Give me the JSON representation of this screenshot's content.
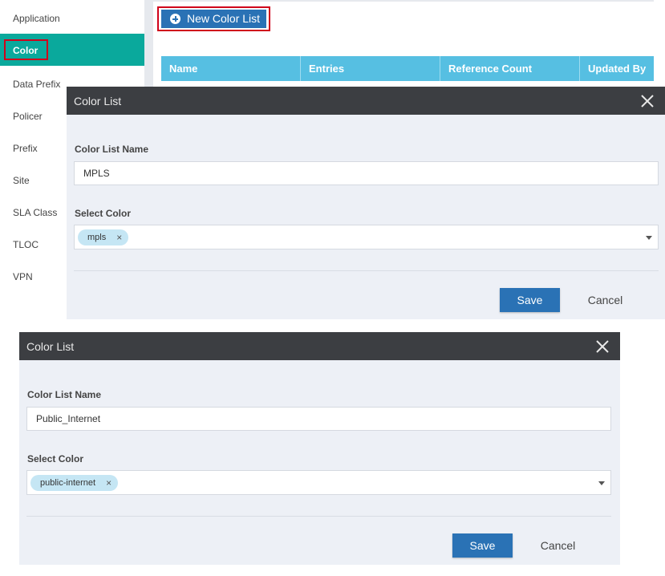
{
  "sidebar": {
    "items": [
      {
        "label": "Application"
      },
      {
        "label": "Color",
        "active": true
      },
      {
        "label": "Data Prefix"
      },
      {
        "label": "Policer"
      },
      {
        "label": "Prefix"
      },
      {
        "label": "Site"
      },
      {
        "label": "SLA Class"
      },
      {
        "label": "TLOC"
      },
      {
        "label": "VPN"
      }
    ]
  },
  "toolbar": {
    "new_label": "New Color List",
    "new_icon": "plus-circle-icon"
  },
  "table": {
    "columns": [
      "Name",
      "Entries",
      "Reference Count",
      "Updated By"
    ]
  },
  "dialogs": [
    {
      "title": "Color List",
      "name_label": "Color List Name",
      "name_value": "MPLS",
      "select_label": "Select Color",
      "selected_chip": "mpls",
      "save_label": "Save",
      "cancel_label": "Cancel"
    },
    {
      "title": "Color List",
      "name_label": "Color List Name",
      "name_value": "Public_Internet",
      "select_label": "Select Color",
      "selected_chip": "public-internet",
      "save_label": "Save",
      "cancel_label": "Cancel"
    }
  ],
  "colors": {
    "accent": "#2a72b5",
    "active_nav": "#0aa99c",
    "table_header": "#56bfe2",
    "dialog_header": "#3c3e42",
    "highlight": "#d0021b"
  }
}
